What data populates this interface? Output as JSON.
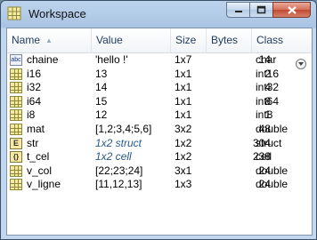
{
  "window": {
    "title": "Workspace",
    "controls": {
      "minimize": "minimize",
      "maximize": "maximize",
      "close": "close"
    }
  },
  "columns": {
    "name": "Name",
    "value": "Value",
    "size": "Size",
    "bytes": "Bytes",
    "class": "Class"
  },
  "variables": [
    {
      "icon": "char-icon",
      "name": "chaine",
      "value": "'hello !'",
      "size": "1x7",
      "bytes": "14",
      "class": "char",
      "italic": false
    },
    {
      "icon": "matrix-icon",
      "name": "i16",
      "value": "13",
      "size": "1x1",
      "bytes": "2",
      "class": "int16",
      "italic": false
    },
    {
      "icon": "matrix-icon",
      "name": "i32",
      "value": "14",
      "size": "1x1",
      "bytes": "4",
      "class": "int32",
      "italic": false
    },
    {
      "icon": "matrix-icon",
      "name": "i64",
      "value": "15",
      "size": "1x1",
      "bytes": "8",
      "class": "int64",
      "italic": false
    },
    {
      "icon": "matrix-icon",
      "name": "i8",
      "value": "12",
      "size": "1x1",
      "bytes": "1",
      "class": "int8",
      "italic": false
    },
    {
      "icon": "matrix-icon",
      "name": "mat",
      "value": "[1,2;3,4;5,6]",
      "size": "3x2",
      "bytes": "48",
      "class": "double",
      "italic": false
    },
    {
      "icon": "struct-icon",
      "name": "str",
      "value": "1x2 struct",
      "size": "1x2",
      "bytes": "304",
      "class": "struct",
      "italic": true
    },
    {
      "icon": "cell-icon",
      "name": "t_cel",
      "value": "1x2 cell",
      "size": "1x2",
      "bytes": "238",
      "class": "cell",
      "italic": true
    },
    {
      "icon": "matrix-icon",
      "name": "v_col",
      "value": "[22;23;24]",
      "size": "3x1",
      "bytes": "24",
      "class": "double",
      "italic": false
    },
    {
      "icon": "matrix-icon",
      "name": "v_ligne",
      "value": "[11,12,13]",
      "size": "1x3",
      "bytes": "24",
      "class": "double",
      "italic": false
    }
  ]
}
